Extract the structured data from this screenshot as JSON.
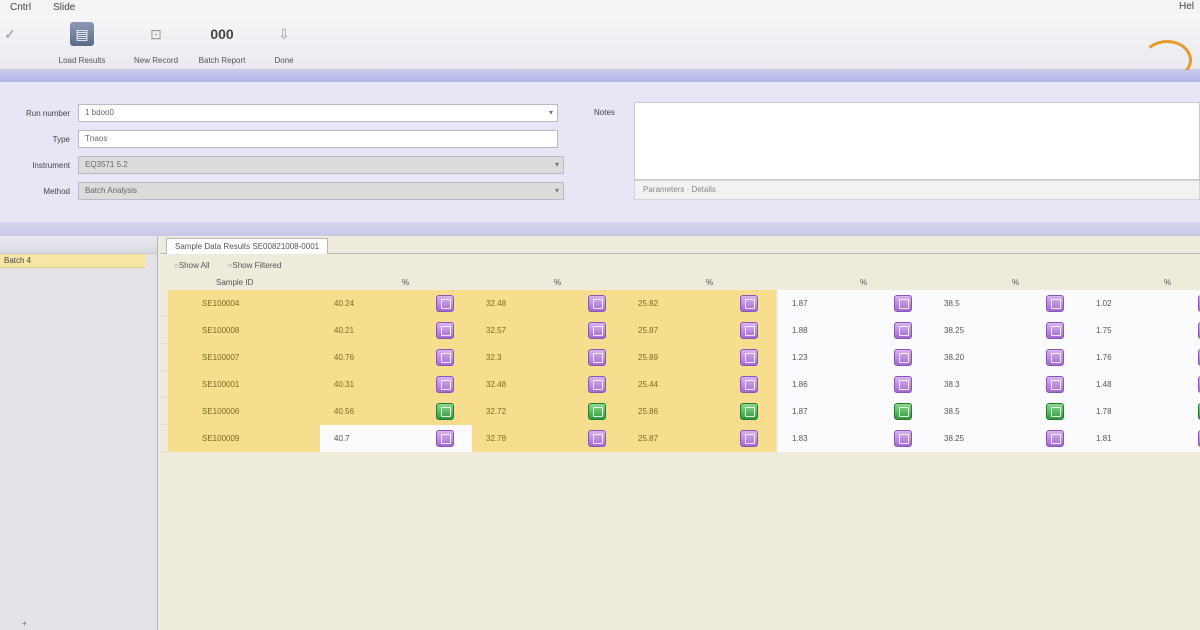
{
  "menu": {
    "items": [
      "Cntrl",
      "Slide"
    ],
    "right": "Hel"
  },
  "toolbar": {
    "buttons": [
      {
        "icon": "ok-icon",
        "label": ""
      },
      {
        "icon": "disk-icon",
        "label": "Load Results"
      },
      {
        "icon": "record-icon",
        "label": "New Record"
      },
      {
        "icon": "text-icon",
        "label": "Batch Report"
      },
      {
        "icon": "down-arrow-icon",
        "label": "Done"
      }
    ],
    "glyphs": {
      "ok": "✓",
      "disk": "▤",
      "record": "⊡",
      "text": "000",
      "down": "⇩"
    }
  },
  "form": {
    "fields": [
      {
        "label": "Run number",
        "value": "1 bdoo0",
        "readonly": false
      },
      {
        "label": "Type",
        "value": "Tnaos",
        "readonly": false
      },
      {
        "label": "Instrument",
        "value": "EQ3571 5.2",
        "readonly": true
      },
      {
        "label": "Method",
        "value": "Batch Analysis",
        "readonly": true
      }
    ],
    "notes_label": "Notes",
    "notes_footer": "Parameters  ·  Details"
  },
  "left_panel": {
    "selected_item": "Batch 4",
    "bottom_label": "+"
  },
  "right_panel": {
    "tab_label": "Sample Data Results  SE00821008-0001",
    "sub_options": [
      "Show All",
      "Show Filtered"
    ]
  },
  "grid": {
    "headers": {
      "sample": "Sample ID",
      "block": "%"
    },
    "colors": {
      "highlight": "#f6de8e",
      "badge_purple": "#a26ccf",
      "badge_green": "#2f9a3f"
    },
    "rows": [
      {
        "sample": "SE100004",
        "v": [
          "40.24",
          "32.48",
          "25.82",
          "1.87",
          "38.5",
          "1.02"
        ],
        "status": "purple",
        "highlight_count": 3
      },
      {
        "sample": "SE100008",
        "v": [
          "40.21",
          "32.57",
          "25.87",
          "1.88",
          "38.25",
          "1.75"
        ],
        "status": "purple",
        "highlight_count": 3
      },
      {
        "sample": "SE100007",
        "v": [
          "40.76",
          "32.3",
          "25.89",
          "1.23",
          "38.20",
          "1.76"
        ],
        "status": "purple",
        "highlight_count": 3
      },
      {
        "sample": "SE100001",
        "v": [
          "40.31",
          "32.48",
          "25.44",
          "1.86",
          "38.3",
          "1.48"
        ],
        "status": "purple",
        "highlight_count": 3
      },
      {
        "sample": "SE100006",
        "v": [
          "40.56",
          "32.72",
          "25.86",
          "1.87",
          "38.5",
          "1.78"
        ],
        "status": "green",
        "highlight_count": 3
      },
      {
        "sample": "SE100009",
        "v": [
          "40.7",
          "32.78",
          "25.87",
          "1.83",
          "38.25",
          "1.81"
        ],
        "status": "purple",
        "highlight_count": 1
      }
    ]
  }
}
